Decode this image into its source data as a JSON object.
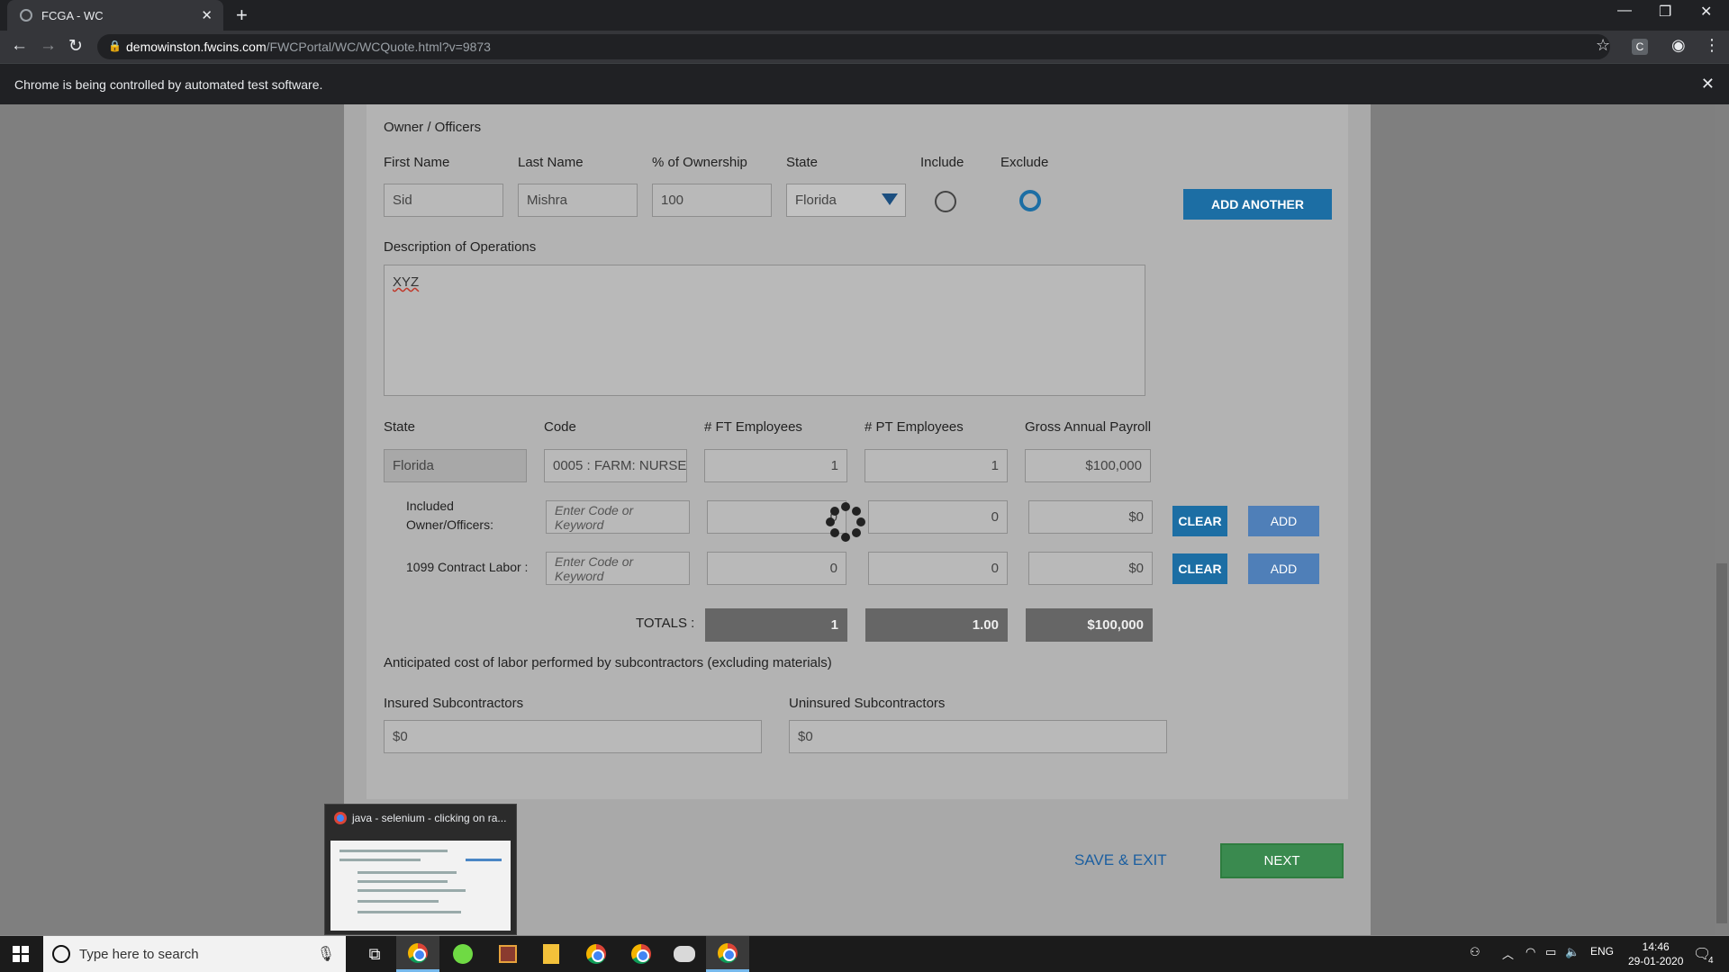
{
  "browser": {
    "tab_title": "FCGA - WC",
    "url_host": "demowinston.fwcins.com",
    "url_path": "/FWCPortal/WC/WCQuote.html?v=9873",
    "infobar_text": "Chrome is being controlled by automated test software.",
    "extension_label": "C"
  },
  "owners": {
    "section_title": "Owner / Officers",
    "first_name_label": "First Name",
    "last_name_label": "Last Name",
    "ownership_label": "% of Ownership",
    "state_label": "State",
    "include_label": "Include",
    "exclude_label": "Exclude",
    "first_name": "Sid",
    "last_name": "Mishra",
    "ownership": "100",
    "state": "Florida",
    "selected": "Exclude",
    "add_another": "ADD ANOTHER"
  },
  "operations": {
    "label": "Description of Operations",
    "value": "XYZ"
  },
  "classes": {
    "headers": {
      "state": "State",
      "code": "Code",
      "ft": "# FT Employees",
      "pt": "# PT Employees",
      "payroll": "Gross Annual Payroll"
    },
    "main_row": {
      "state": "Florida",
      "code": "0005 : FARM: NURSE",
      "ft": "1",
      "pt": "1",
      "payroll": "$100,000"
    },
    "included_row": {
      "label_line1": "Included",
      "label_line2": "Owner/Officers:",
      "code_placeholder": "Enter Code or Keyword",
      "ft": "0",
      "pt": "0",
      "payroll": "$0",
      "clear": "CLEAR",
      "add": "ADD"
    },
    "contract_row": {
      "label": "1099 Contract Labor :",
      "code_placeholder": "Enter Code or Keyword",
      "ft": "0",
      "pt": "0",
      "payroll": "$0",
      "clear": "CLEAR",
      "add": "ADD"
    },
    "totals": {
      "label": "TOTALS :",
      "ft": "1",
      "pt": "1.00",
      "payroll": "$100,000"
    }
  },
  "subcontractors": {
    "intro": "Anticipated cost of labor performed by subcontractors (excluding materials)",
    "insured_label": "Insured Subcontractors",
    "insured_value": "$0",
    "uninsured_label": "Uninsured Subcontractors",
    "uninsured_value": "$0"
  },
  "footer": {
    "save_exit": "SAVE & EXIT",
    "next": "NEXT"
  },
  "taskbar_popup": {
    "title": "java - selenium - clicking on ra..."
  },
  "taskbar": {
    "search_placeholder": "Type here to search",
    "language": "ENG",
    "time": "14:46",
    "date": "29-01-2020",
    "notification_count": "4"
  },
  "colors": {
    "primary_button": "#1c6ea4",
    "add_button": "#4f7fb8",
    "next_button": "#3a8a4f",
    "save_exit_link": "#1c5fa0"
  }
}
